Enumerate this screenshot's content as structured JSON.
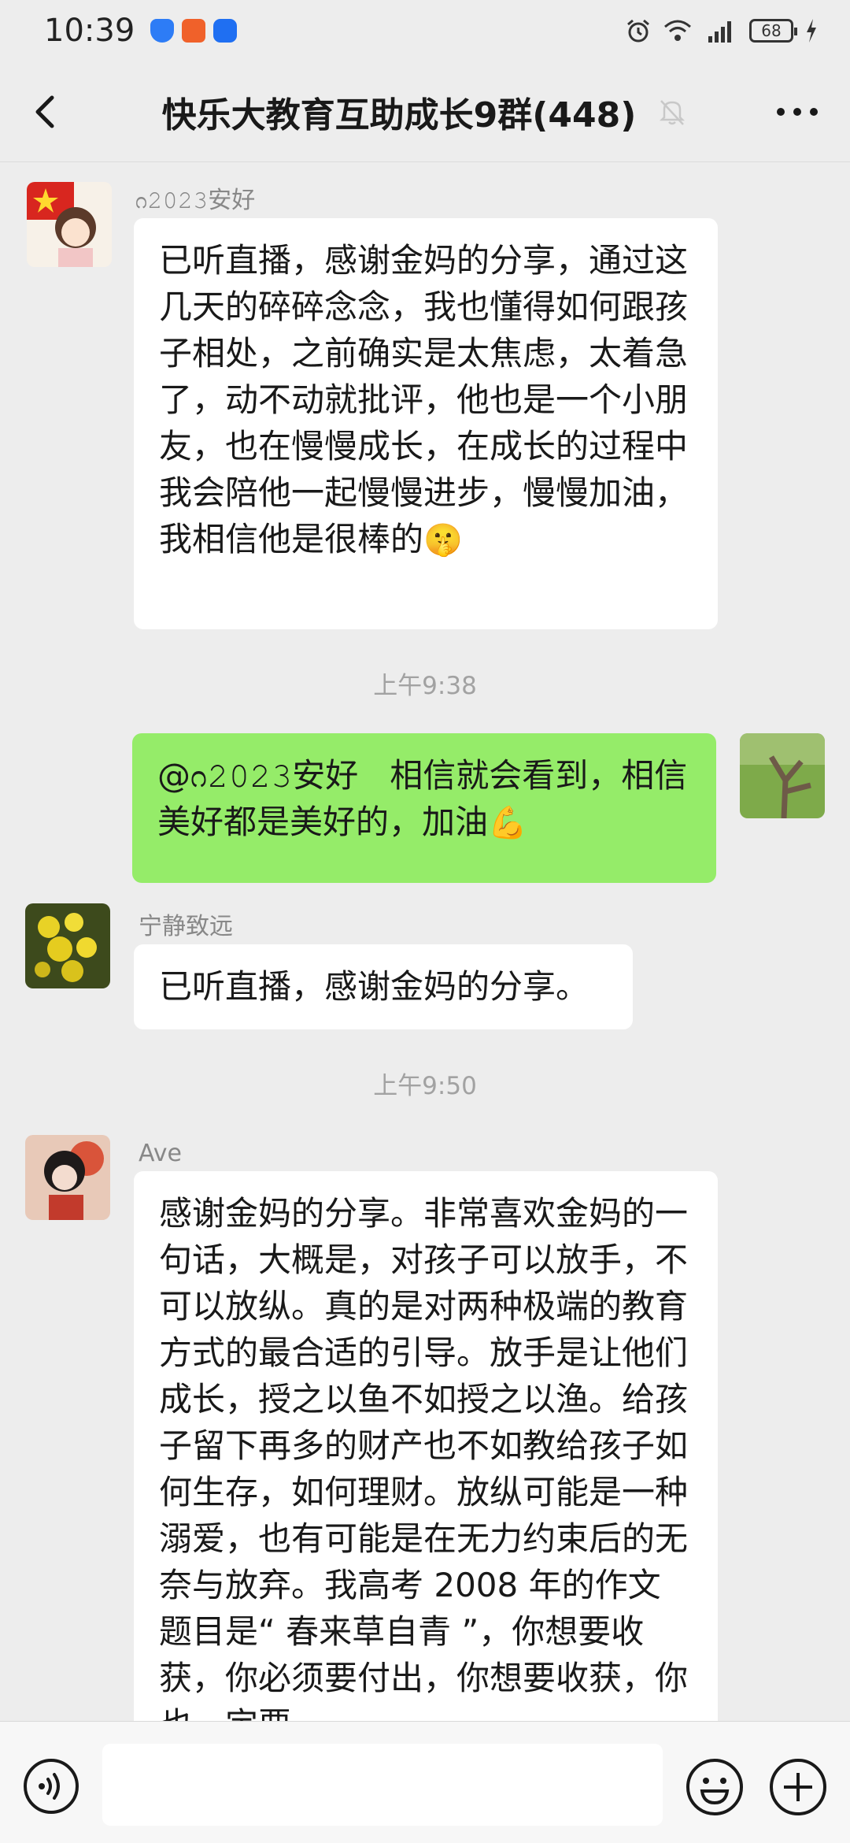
{
  "status_bar": {
    "time": "10:39",
    "battery": "68"
  },
  "nav": {
    "title": "快乐大教育互助成长9群(448)"
  },
  "messages": [
    {
      "sender": "ᦅ𝟸𝟶𝟸𝟹安好",
      "text": "已听直播，感谢金妈的分享，通过这几天的碎碎念念，我也懂得如何跟孩子相处，之前确实是太焦虑，太着急了，动不动就批评，他也是一个小朋友，也在慢慢成长，在成长的过程中我会陪他一起慢慢进步，慢慢加油，我相信他是很棒的",
      "emoji": "🤫"
    },
    {
      "timestamp": "上午9:38"
    },
    {
      "mention": "@ᦅ𝟸𝟶𝟸𝟹安好",
      "text": "相信就会看到，相信美好都是美好的，加油",
      "emoji": "💪"
    },
    {
      "sender": "宁静致远",
      "text": "已听直播，感谢金妈的分享。"
    },
    {
      "timestamp": "上午9:50"
    },
    {
      "sender": "Ave",
      "text": "感谢金妈的分享。非常喜欢金妈的一句话，大概是，对孩子可以放手，不可以放纵。真的是对两种极端的教育方式的最合适的引导。放手是让他们成长，授之以鱼不如授之以渔。给孩子留下再多的财产也不如教给孩子如何生存，如何理财。放纵可能是一种溺爱，也有可能是在无力约束后的无奈与放弃。我高考 2008 年的作文题目是“ 春来草自青 ”，你想要收获，你必须要付出，你想要收获，你也一定要"
    }
  ],
  "colors": {
    "background": "#ededed",
    "bubble_self": "#95ec69",
    "bubble_other": "#ffffff",
    "timestamp": "#a2a2a2"
  },
  "icons": {
    "back": "chevron-left-icon",
    "mute": "bell-off-icon",
    "more": "more-dots-icon",
    "voice": "voice-icon",
    "emoji": "smiley-icon",
    "plus": "plus-circle-icon"
  }
}
